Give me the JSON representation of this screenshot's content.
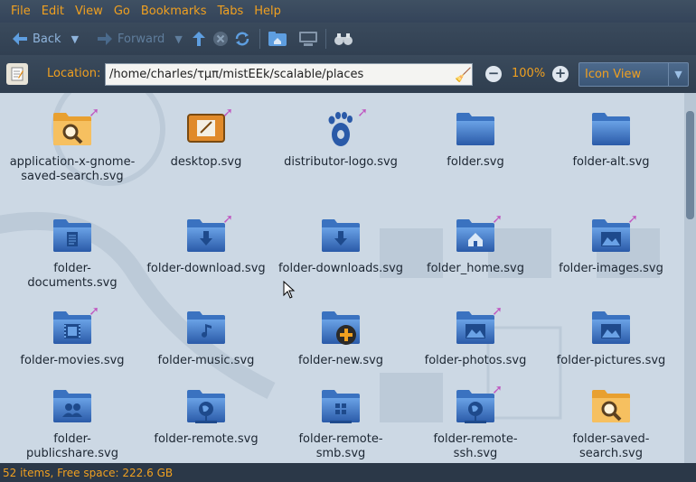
{
  "menu": [
    "File",
    "Edit",
    "View",
    "Go",
    "Bookmarks",
    "Tabs",
    "Help"
  ],
  "toolbar": {
    "back_label": "Back",
    "forward_label": "Forward"
  },
  "location": {
    "label": "Location:",
    "path": "/home/charles/τμπ/mistEEk/scalable/places",
    "zoom": "100%",
    "view_mode": "Icon View"
  },
  "files": [
    {
      "name": "application-x-gnome-saved-search.svg",
      "icon": "saved-search-icon",
      "badge": true
    },
    {
      "name": "desktop.svg",
      "icon": "desktop-icon",
      "badge": true
    },
    {
      "name": "distributor-logo.svg",
      "icon": "gnome-foot-icon",
      "badge": true
    },
    {
      "name": "folder.svg",
      "icon": "folder-icon",
      "badge": false
    },
    {
      "name": "folder-alt.svg",
      "icon": "folder-icon",
      "badge": false
    },
    {
      "name": "folder-documents.svg",
      "icon": "folder-documents-icon",
      "badge": false
    },
    {
      "name": "folder-download.svg",
      "icon": "folder-download-icon",
      "badge": true
    },
    {
      "name": "folder-downloads.svg",
      "icon": "folder-download-icon",
      "badge": false
    },
    {
      "name": "folder_home.svg",
      "icon": "folder-home-icon",
      "badge": true
    },
    {
      "name": "folder-images.svg",
      "icon": "folder-images-icon",
      "badge": true
    },
    {
      "name": "folder-movies.svg",
      "icon": "folder-movies-icon",
      "badge": true
    },
    {
      "name": "folder-music.svg",
      "icon": "folder-music-icon",
      "badge": false
    },
    {
      "name": "folder-new.svg",
      "icon": "folder-new-icon",
      "badge": false
    },
    {
      "name": "folder-photos.svg",
      "icon": "folder-images-icon",
      "badge": true
    },
    {
      "name": "folder-pictures.svg",
      "icon": "folder-images-icon",
      "badge": false
    },
    {
      "name": "folder-publicshare.svg",
      "icon": "folder-publicshare-icon",
      "badge": false
    },
    {
      "name": "folder-remote.svg",
      "icon": "folder-remote-icon",
      "badge": false
    },
    {
      "name": "folder-remote-smb.svg",
      "icon": "folder-remote-smb-icon",
      "badge": false
    },
    {
      "name": "folder-remote-ssh.svg",
      "icon": "folder-remote-icon",
      "badge": true
    },
    {
      "name": "folder-saved-search.svg",
      "icon": "saved-search-icon",
      "badge": false
    }
  ],
  "status": "52 items, Free space: 222.6 GB",
  "colors": {
    "accent": "#f0a020",
    "folder_blue": "#3a72c0",
    "content_bg": "#ccd8e4"
  }
}
